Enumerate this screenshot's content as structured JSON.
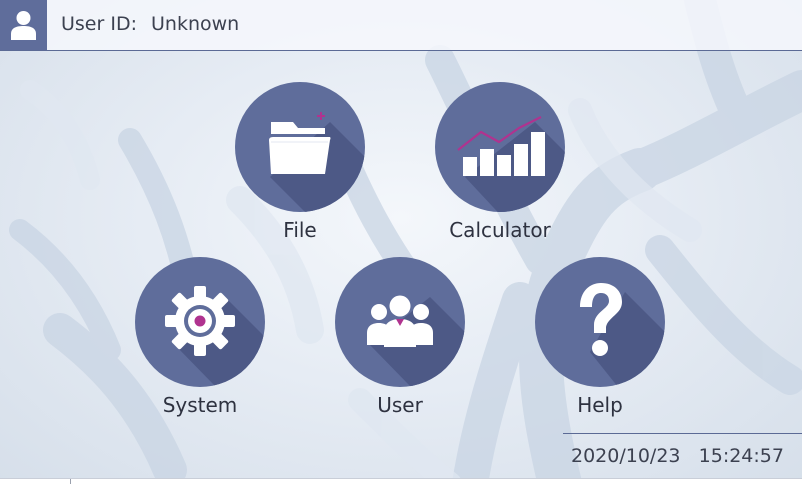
{
  "header": {
    "user_label": "User ID:",
    "user_value": "Unknown",
    "avatar_icon": "user-icon"
  },
  "tiles": [
    {
      "label": "File",
      "icon": "folder-add-icon"
    },
    {
      "label": "Calculator",
      "icon": "chart-icon"
    },
    {
      "label": "System",
      "icon": "gear-icon"
    },
    {
      "label": "User",
      "icon": "users-group-icon"
    },
    {
      "label": "Help",
      "icon": "question-mark-icon"
    }
  ],
  "footer": {
    "date": "2020/10/23",
    "time": "15:24:57"
  },
  "colors": {
    "tile": "#5f6d9b",
    "tile_shadow": "#4d5986",
    "accent": "#b0338f",
    "icon": "#ffffff"
  }
}
